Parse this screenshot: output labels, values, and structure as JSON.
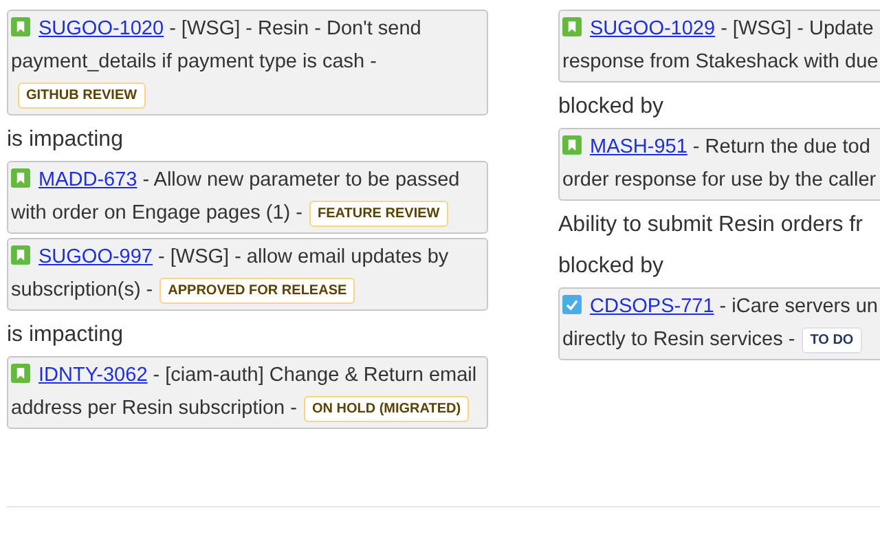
{
  "columns": [
    {
      "items": [
        {
          "kind": "issue",
          "issue_type": {
            "kind": "story"
          },
          "key": "SUGOO-1020",
          "lines": [
            "- [WSG] - Resin - Don't send",
            "payment_details if payment type is cash -"
          ],
          "status": {
            "label": "GITHUB REVIEW",
            "kind": "inprogress"
          }
        },
        {
          "kind": "relation",
          "text": "is impacting"
        },
        {
          "kind": "issue",
          "issue_type": {
            "kind": "story"
          },
          "key": "MADD-673",
          "lines": [
            "- Allow new parameter to be passed",
            "with order on Engage pages (1) -"
          ],
          "status": {
            "label": "FEATURE REVIEW",
            "kind": "inprogress"
          }
        },
        {
          "kind": "issue",
          "issue_type": {
            "kind": "story"
          },
          "key": "SUGOO-997",
          "lines": [
            "- [WSG] - allow email updates by",
            "subscription(s) -"
          ],
          "status": {
            "label": "APPROVED FOR RELEASE",
            "kind": "inprogress"
          }
        },
        {
          "kind": "relation",
          "text": "is impacting"
        },
        {
          "kind": "issue",
          "issue_type": {
            "kind": "story"
          },
          "key": "IDNTY-3062",
          "lines": [
            "- [ciam-auth] Change & Return email",
            "address per Resin subscription -"
          ],
          "status": {
            "label": "ON HOLD (MIGRATED)",
            "kind": "inprogress"
          }
        }
      ]
    },
    {
      "items": [
        {
          "kind": "issue",
          "issue_type": {
            "kind": "story"
          },
          "key": "SUGOO-1029",
          "lines": [
            "- [WSG] - Update",
            "response from Stakeshack with due"
          ]
        },
        {
          "kind": "relation",
          "text": "blocked by"
        },
        {
          "kind": "issue",
          "issue_type": {
            "kind": "story"
          },
          "key": "MASH-951",
          "lines": [
            "- Return the due tod",
            "order response for use by the caller"
          ]
        },
        {
          "kind": "relation",
          "text": "Ability to submit Resin orders fr"
        },
        {
          "kind": "relation",
          "text": "blocked by"
        },
        {
          "kind": "issue",
          "issue_type": {
            "kind": "task"
          },
          "key": "CDSOPS-771",
          "lines": [
            "- iCare servers un",
            "directly to Resin services -"
          ],
          "status": {
            "label": "TO DO",
            "kind": "todo"
          }
        }
      ]
    }
  ]
}
